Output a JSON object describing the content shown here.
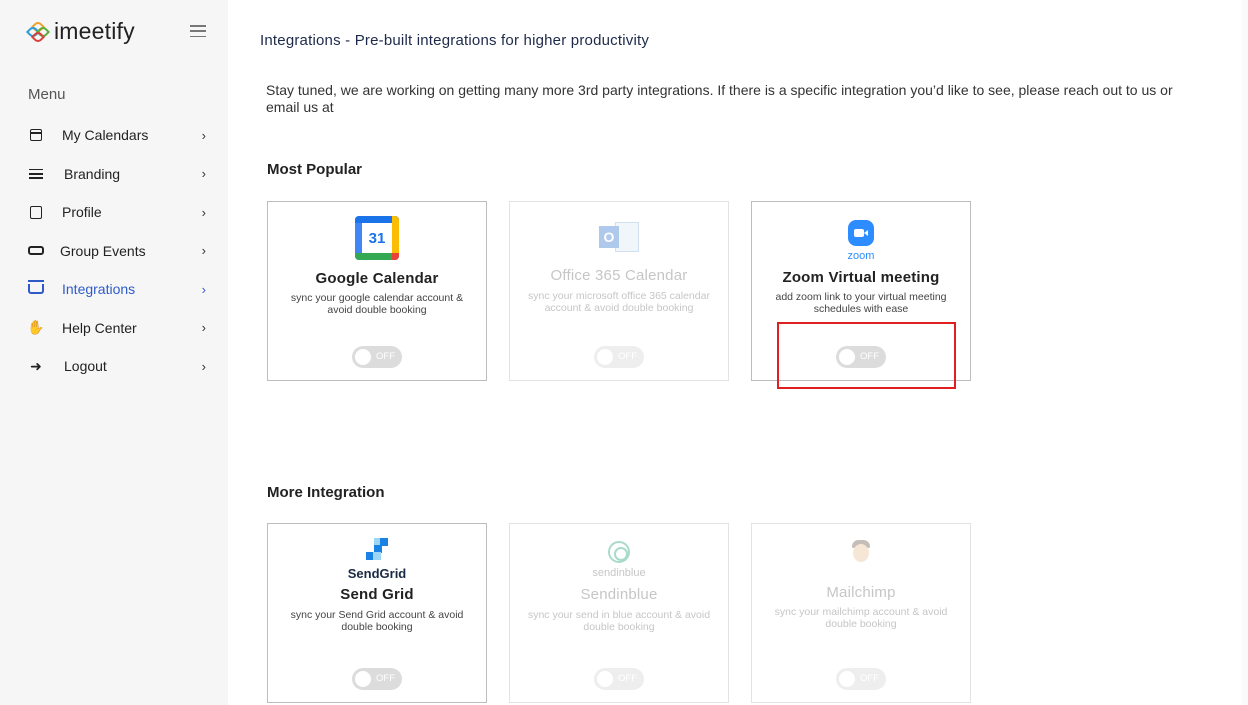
{
  "app": {
    "name": "imeetify"
  },
  "sidebar": {
    "menu_title": "Menu",
    "items": [
      {
        "label": "My Calendars",
        "icon": "calendar-icon",
        "chevron": "›"
      },
      {
        "label": "Branding",
        "icon": "sliders-icon",
        "chevron": "›"
      },
      {
        "label": "Profile",
        "icon": "profile-icon",
        "chevron": "›"
      },
      {
        "label": "Group Events",
        "icon": "group-events-icon",
        "chevron": "›"
      },
      {
        "label": "Integrations",
        "icon": "basket-icon",
        "chevron": "›",
        "active": true
      },
      {
        "label": "Help Center",
        "icon": "hand-icon",
        "chevron": "›"
      },
      {
        "label": "Logout",
        "icon": "logout-icon",
        "chevron": "›"
      }
    ]
  },
  "main": {
    "title": "Integrations - Pre-built integrations for higher productivity",
    "note": "Stay tuned, we are working on getting many more 3rd party integrations. If there is a specific integration you’d like to see, please reach out to us or email us at",
    "sections": [
      {
        "title": "Most Popular",
        "cards": [
          {
            "name": "Google Calendar",
            "logo_text": "31",
            "desc": "sync your google calendar account & avoid double booking",
            "toggle": "OFF",
            "enabled": true
          },
          {
            "name": "Office 365 Calendar",
            "logo_text": "O",
            "desc": "sync your microsoft office 365 calendar account & avoid double booking",
            "toggle": "OFF",
            "enabled": false
          },
          {
            "name": "Zoom Virtual meeting",
            "brand_word": "zoom",
            "desc": "add zoom link to your virtual meeting schedules with ease",
            "toggle": "OFF",
            "enabled": true
          }
        ]
      },
      {
        "title": "More Integration",
        "cards": [
          {
            "name": "Send Grid",
            "brand_word": "SendGrid",
            "desc": "sync your Send Grid account & avoid double booking",
            "toggle": "OFF",
            "enabled": true
          },
          {
            "name": "Sendinblue",
            "brand_word": "sendinblue",
            "desc": "sync your send in blue account & avoid double booking",
            "toggle": "OFF",
            "enabled": false
          },
          {
            "name": "Mailchimp",
            "desc": "sync your mailchimp account & avoid double booking",
            "toggle": "OFF",
            "enabled": false
          }
        ]
      }
    ]
  },
  "colors": {
    "accent": "#2f5bc9",
    "highlight": "#e02020",
    "zoom": "#2d8cff",
    "sendgrid": "#1a82e2"
  }
}
